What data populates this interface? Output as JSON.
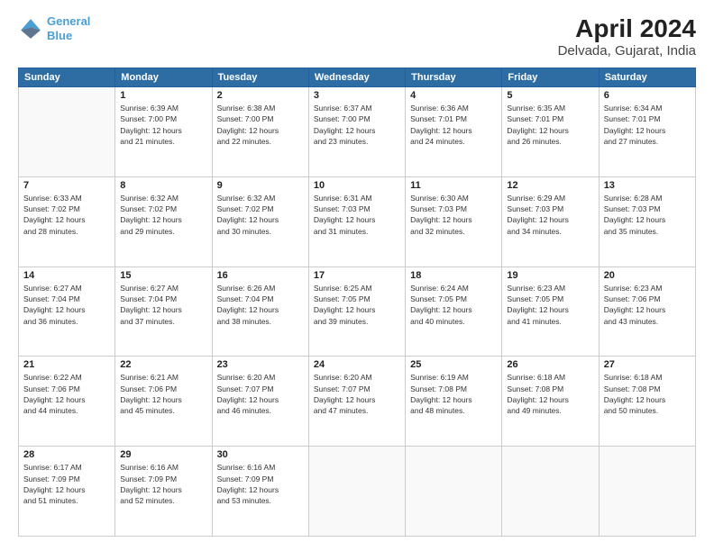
{
  "header": {
    "logo_line1": "General",
    "logo_line2": "Blue",
    "title": "April 2024",
    "subtitle": "Delvada, Gujarat, India"
  },
  "calendar": {
    "weekdays": [
      "Sunday",
      "Monday",
      "Tuesday",
      "Wednesday",
      "Thursday",
      "Friday",
      "Saturday"
    ],
    "weeks": [
      [
        {
          "day": "",
          "info": ""
        },
        {
          "day": "1",
          "info": "Sunrise: 6:39 AM\nSunset: 7:00 PM\nDaylight: 12 hours\nand 21 minutes."
        },
        {
          "day": "2",
          "info": "Sunrise: 6:38 AM\nSunset: 7:00 PM\nDaylight: 12 hours\nand 22 minutes."
        },
        {
          "day": "3",
          "info": "Sunrise: 6:37 AM\nSunset: 7:00 PM\nDaylight: 12 hours\nand 23 minutes."
        },
        {
          "day": "4",
          "info": "Sunrise: 6:36 AM\nSunset: 7:01 PM\nDaylight: 12 hours\nand 24 minutes."
        },
        {
          "day": "5",
          "info": "Sunrise: 6:35 AM\nSunset: 7:01 PM\nDaylight: 12 hours\nand 26 minutes."
        },
        {
          "day": "6",
          "info": "Sunrise: 6:34 AM\nSunset: 7:01 PM\nDaylight: 12 hours\nand 27 minutes."
        }
      ],
      [
        {
          "day": "7",
          "info": "Sunrise: 6:33 AM\nSunset: 7:02 PM\nDaylight: 12 hours\nand 28 minutes."
        },
        {
          "day": "8",
          "info": "Sunrise: 6:32 AM\nSunset: 7:02 PM\nDaylight: 12 hours\nand 29 minutes."
        },
        {
          "day": "9",
          "info": "Sunrise: 6:32 AM\nSunset: 7:02 PM\nDaylight: 12 hours\nand 30 minutes."
        },
        {
          "day": "10",
          "info": "Sunrise: 6:31 AM\nSunset: 7:03 PM\nDaylight: 12 hours\nand 31 minutes."
        },
        {
          "day": "11",
          "info": "Sunrise: 6:30 AM\nSunset: 7:03 PM\nDaylight: 12 hours\nand 32 minutes."
        },
        {
          "day": "12",
          "info": "Sunrise: 6:29 AM\nSunset: 7:03 PM\nDaylight: 12 hours\nand 34 minutes."
        },
        {
          "day": "13",
          "info": "Sunrise: 6:28 AM\nSunset: 7:03 PM\nDaylight: 12 hours\nand 35 minutes."
        }
      ],
      [
        {
          "day": "14",
          "info": "Sunrise: 6:27 AM\nSunset: 7:04 PM\nDaylight: 12 hours\nand 36 minutes."
        },
        {
          "day": "15",
          "info": "Sunrise: 6:27 AM\nSunset: 7:04 PM\nDaylight: 12 hours\nand 37 minutes."
        },
        {
          "day": "16",
          "info": "Sunrise: 6:26 AM\nSunset: 7:04 PM\nDaylight: 12 hours\nand 38 minutes."
        },
        {
          "day": "17",
          "info": "Sunrise: 6:25 AM\nSunset: 7:05 PM\nDaylight: 12 hours\nand 39 minutes."
        },
        {
          "day": "18",
          "info": "Sunrise: 6:24 AM\nSunset: 7:05 PM\nDaylight: 12 hours\nand 40 minutes."
        },
        {
          "day": "19",
          "info": "Sunrise: 6:23 AM\nSunset: 7:05 PM\nDaylight: 12 hours\nand 41 minutes."
        },
        {
          "day": "20",
          "info": "Sunrise: 6:23 AM\nSunset: 7:06 PM\nDaylight: 12 hours\nand 43 minutes."
        }
      ],
      [
        {
          "day": "21",
          "info": "Sunrise: 6:22 AM\nSunset: 7:06 PM\nDaylight: 12 hours\nand 44 minutes."
        },
        {
          "day": "22",
          "info": "Sunrise: 6:21 AM\nSunset: 7:06 PM\nDaylight: 12 hours\nand 45 minutes."
        },
        {
          "day": "23",
          "info": "Sunrise: 6:20 AM\nSunset: 7:07 PM\nDaylight: 12 hours\nand 46 minutes."
        },
        {
          "day": "24",
          "info": "Sunrise: 6:20 AM\nSunset: 7:07 PM\nDaylight: 12 hours\nand 47 minutes."
        },
        {
          "day": "25",
          "info": "Sunrise: 6:19 AM\nSunset: 7:08 PM\nDaylight: 12 hours\nand 48 minutes."
        },
        {
          "day": "26",
          "info": "Sunrise: 6:18 AM\nSunset: 7:08 PM\nDaylight: 12 hours\nand 49 minutes."
        },
        {
          "day": "27",
          "info": "Sunrise: 6:18 AM\nSunset: 7:08 PM\nDaylight: 12 hours\nand 50 minutes."
        }
      ],
      [
        {
          "day": "28",
          "info": "Sunrise: 6:17 AM\nSunset: 7:09 PM\nDaylight: 12 hours\nand 51 minutes."
        },
        {
          "day": "29",
          "info": "Sunrise: 6:16 AM\nSunset: 7:09 PM\nDaylight: 12 hours\nand 52 minutes."
        },
        {
          "day": "30",
          "info": "Sunrise: 6:16 AM\nSunset: 7:09 PM\nDaylight: 12 hours\nand 53 minutes."
        },
        {
          "day": "",
          "info": ""
        },
        {
          "day": "",
          "info": ""
        },
        {
          "day": "",
          "info": ""
        },
        {
          "day": "",
          "info": ""
        }
      ]
    ]
  }
}
